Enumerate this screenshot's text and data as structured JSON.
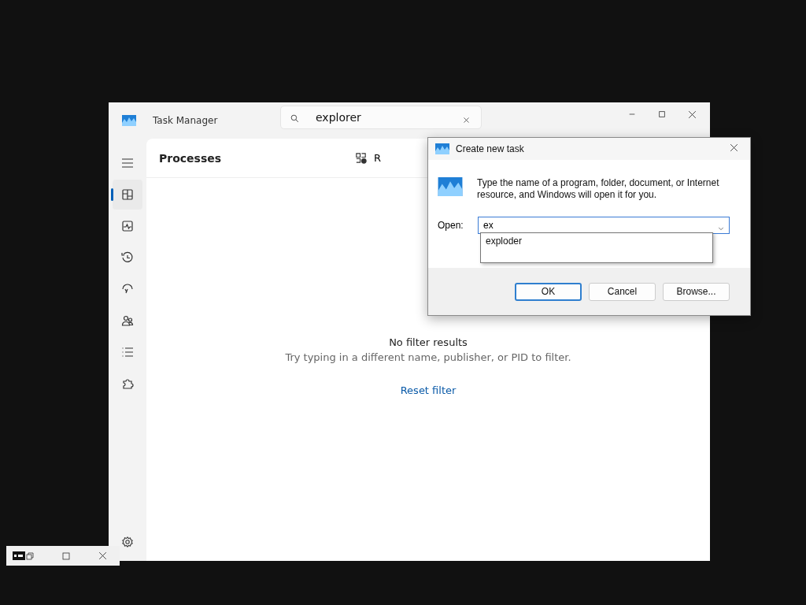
{
  "task_manager": {
    "title": "Task Manager",
    "search": {
      "value": "explorer"
    },
    "nav": [
      {
        "kind": "menu",
        "selected": false
      },
      {
        "kind": "processes",
        "selected": true
      },
      {
        "kind": "performance",
        "selected": false
      },
      {
        "kind": "history",
        "selected": false
      },
      {
        "kind": "startup",
        "selected": false
      },
      {
        "kind": "users",
        "selected": false
      },
      {
        "kind": "details",
        "selected": false
      },
      {
        "kind": "services",
        "selected": false
      }
    ],
    "page_title": "Processes",
    "toolbar_button": "R",
    "empty_title": "No filter results",
    "empty_hint": "Try typing in a different name, publisher, or PID to filter.",
    "reset_link": "Reset filter"
  },
  "dialog": {
    "title": "Create new task",
    "message": "Type the name of a program, folder, document, or Internet resource, and Windows will open it for you.",
    "open_label": "Open:",
    "open_value": "ex",
    "suggestions": [
      "exploder"
    ],
    "buttons": [
      {
        "label": "OK",
        "default": true
      },
      {
        "label": "Cancel",
        "default": false
      },
      {
        "label": "Browse...",
        "default": false
      }
    ]
  }
}
